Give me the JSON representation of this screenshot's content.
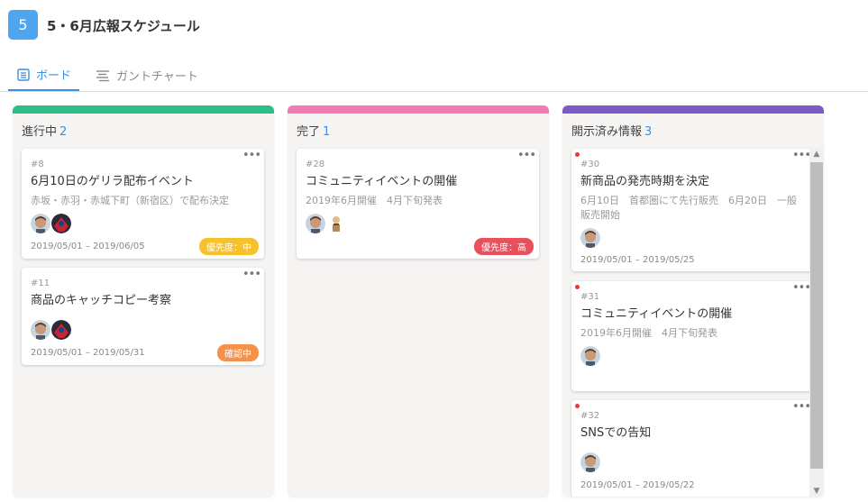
{
  "project": {
    "badge": "5",
    "title": "5・6月広報スケジュール"
  },
  "tabs": [
    {
      "label": "ボード",
      "icon": "board-icon",
      "active": true
    },
    {
      "label": "ガントチャート",
      "icon": "gantt-icon",
      "active": false
    }
  ],
  "columns": [
    {
      "name": "進行中",
      "count": "2",
      "color": "#2dbf8a",
      "cards": [
        {
          "num": "#8",
          "title": "6月10日のゲリラ配布イベント",
          "desc": "赤坂・赤羽・赤城下町（新宿区）で配布決定",
          "date": "2019/05/01 – 2019/06/05",
          "badge": "優先度：中",
          "badge_color": "#f7c12e",
          "badge_text_color": "#ffffff"
        },
        {
          "num": "#11",
          "title": "商品のキャッチコピー考察",
          "desc": "",
          "date": "2019/05/01 – 2019/05/31",
          "badge": "確認中",
          "badge_color": "#f5914a",
          "badge_text_color": "#ffffff"
        }
      ]
    },
    {
      "name": "完了",
      "count": "1",
      "color": "#f27bb5",
      "cards": [
        {
          "num": "#28",
          "title": "コミュニティイベントの開催",
          "desc": "2019年6月開催　4月下旬発表",
          "date": "",
          "badge": "優先度：高",
          "badge_color": "#e8505b",
          "badge_text_color": "#ffffff"
        }
      ]
    },
    {
      "name": "開示済み情報",
      "count": "3",
      "color": "#7d5bc4",
      "cards": [
        {
          "num": "#30",
          "title": "新商品の発売時期を決定",
          "desc": "6月10日　首都圏にて先行販売　6月20日　一般販売開始",
          "date": "2019/05/01 – 2019/05/25",
          "badge": ""
        },
        {
          "num": "#31",
          "title": "コミュニティイベントの開催",
          "desc": "2019年6月開催　4月下旬発表",
          "date": "",
          "badge": ""
        },
        {
          "num": "#32",
          "title": "SNSでの告知",
          "desc": "",
          "date": "2019/05/01 – 2019/05/22",
          "badge": ""
        }
      ]
    }
  ]
}
